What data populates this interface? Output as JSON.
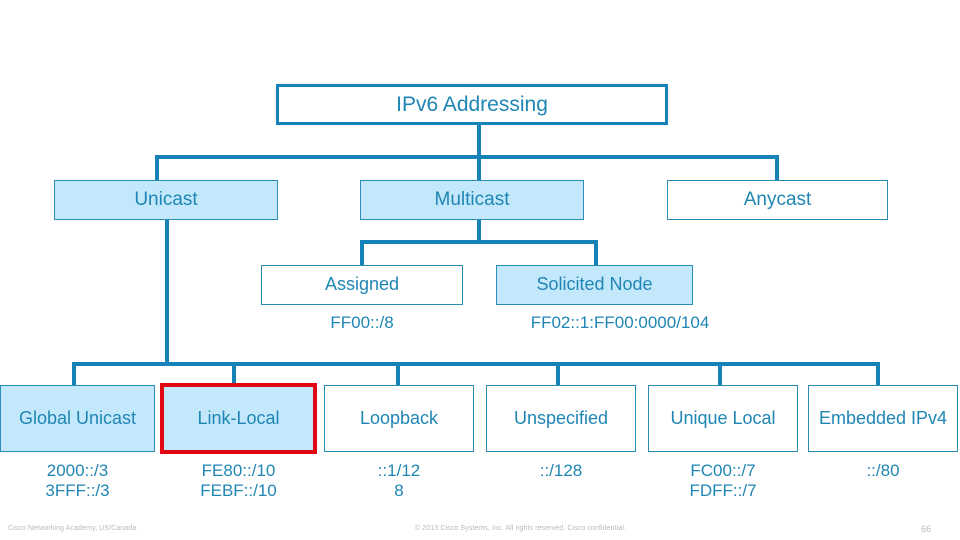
{
  "diagram": {
    "title_box": {
      "label": "IPv6 Addressing"
    },
    "level2": [
      {
        "label": "Unicast",
        "style": "fill"
      },
      {
        "label": "Multicast",
        "style": "fill"
      },
      {
        "label": "Anycast",
        "style": "white"
      }
    ],
    "level3": [
      {
        "label": "Assigned",
        "value": "FF00::/8",
        "style": "white"
      },
      {
        "label": "Solicited Node",
        "value": "FF02::1:FF00:0000/104",
        "style": "fill"
      }
    ],
    "level4": [
      {
        "label": "Global Unicast",
        "value": "2000::/3\n3FFF::/3",
        "style": "fill"
      },
      {
        "label": "Link-Local",
        "value": "FE80::/10\nFEBF::/10",
        "style": "redhl"
      },
      {
        "label": "Loopback",
        "value": "::1/12\n8",
        "style": "white"
      },
      {
        "label": "Unspecified",
        "value": "::/128",
        "style": "white"
      },
      {
        "label": "Unique Local",
        "value": "FC00::/7\nFDFF::/7",
        "style": "white"
      },
      {
        "label": "Embedded IPv4",
        "value": "::/80",
        "style": "white"
      }
    ]
  },
  "footer": {
    "left": "Cisco Networking Academy, US/Canada",
    "center": "© 2013 Cisco Systems, Inc. All rights reserved. Cisco confidential.",
    "page": "66"
  },
  "colors": {
    "accent_blue": "#1583b8",
    "text_blue": "#1f86b4",
    "fill_blue": "#c3e8fb",
    "highlight_red": "#e30613",
    "footer_gray": "#b9b9b9"
  }
}
